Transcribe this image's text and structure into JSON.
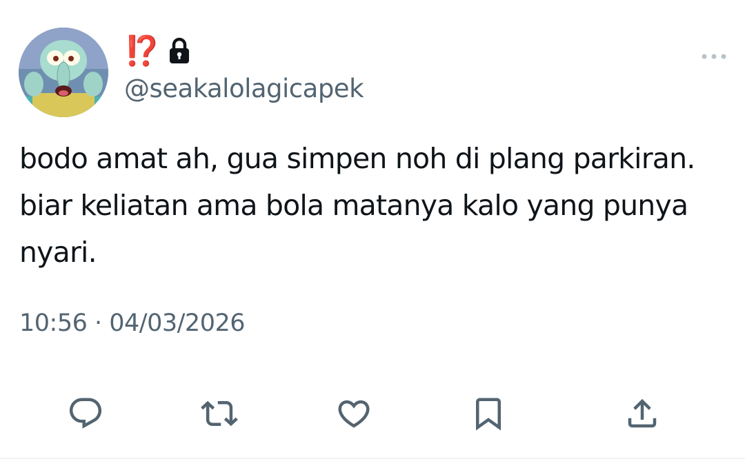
{
  "author": {
    "display_name": "⁉️",
    "handle": "@seakalolagicapek",
    "avatar_icon": "squidward-avatar",
    "protected_icon": "lock-icon"
  },
  "tweet": {
    "text_lines": [
      "bodo amat ah, gua simpen noh di plang parkiran.",
      "biar keliatan ama bola matanya kalo yang punya",
      "nyari."
    ],
    "time": "10:56",
    "separator": " · ",
    "date": "04/03/2026"
  },
  "actions": [
    {
      "name": "reply",
      "icon": "reply-icon"
    },
    {
      "name": "retweet",
      "icon": "retweet-icon"
    },
    {
      "name": "like",
      "icon": "heart-icon"
    },
    {
      "name": "bookmark",
      "icon": "bookmark-icon"
    },
    {
      "name": "share",
      "icon": "share-icon"
    }
  ],
  "colors": {
    "text": "#0f1419",
    "secondary": "#536471",
    "emoji_red": "#e0241b"
  }
}
